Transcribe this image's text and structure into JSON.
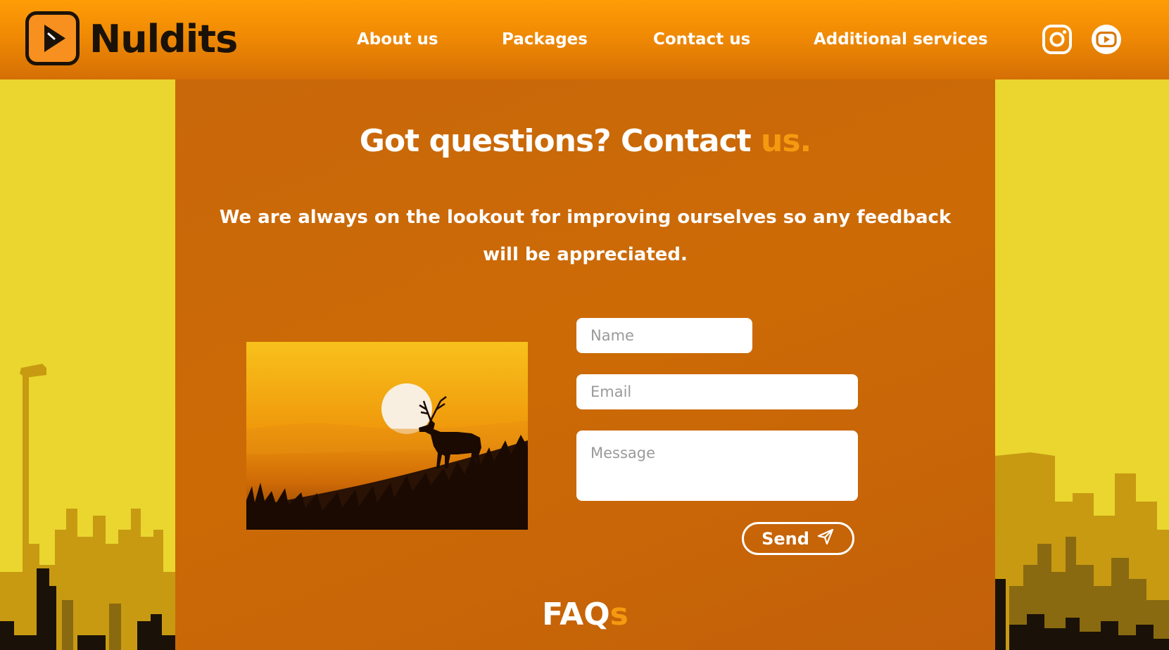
{
  "brand": {
    "name": "Nuldits"
  },
  "nav": {
    "items": [
      {
        "label": "About us"
      },
      {
        "label": "Packages"
      },
      {
        "label": "Contact us"
      },
      {
        "label": "Additional services"
      }
    ]
  },
  "social": {
    "instagram_icon": "instagram-icon",
    "youtube_icon": "youtube-icon"
  },
  "contact": {
    "headline_main": "Got questions? Contact ",
    "headline_accent": "us.",
    "tagline": "We are always on the lookout for improving ourselves so any feedback will be appreciated.",
    "name_placeholder": "Name",
    "email_placeholder": "Email",
    "message_placeholder": "Message",
    "send_label": "Send"
  },
  "faq": {
    "main": "FAQ",
    "accent": "s"
  },
  "colors": {
    "header_orange": "#fe9d06",
    "panel_orange": "#c9680a",
    "accent_orange": "#f59a10",
    "side_yellow": "#ead62f",
    "text_white": "#ffffff",
    "dark": "#1a1208"
  }
}
